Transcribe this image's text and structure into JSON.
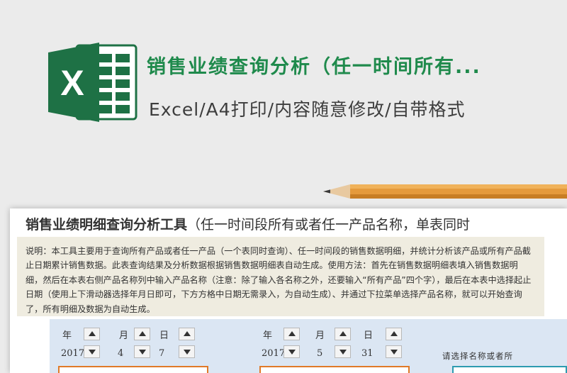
{
  "banner": {
    "title": "销售业绩查询分析（任一时间所有...",
    "subtitle": "Excel/A4打印/内容随意修改/自带格式"
  },
  "colors": {
    "excel_green": "#1e7145",
    "title_green": "#1f8a4c",
    "orange": "#e07a28",
    "teal": "#2d9bb0"
  },
  "sheet": {
    "title_bold": "销售业绩明细查询分析工具",
    "title_rest": "（任一时间段所有或者任一产品名称，单表同时",
    "description": "说明：本工具主要用于查询所有产品或者任一产品（一个表同时查询）、任一时间段的销售数据明细，并统计分析该产品或所有产品截止日期累计销售数据。此表查询结果及分析数据根据销售数据明细表自动生成。使用方法：首先在销售数据明细表填入销售数据明细，然后在本表右侧产品名称列中输入产品名称（注意：除了输入各名称之外，还要输入“所有产品”四个字），最后在本表中选择起止日期（使用上下滑动器选择年月日即可，下方方格中日期无需录入，为自动生成）、并通过下拉菜单选择产品名称，就可以开始查询了，所有明细及数据为自动生成。",
    "start_date": {
      "year_label": "年",
      "month_label": "月",
      "day_label": "日",
      "year": "2017",
      "month": "4",
      "day": "7"
    },
    "end_date": {
      "year_label": "年",
      "month_label": "月",
      "day_label": "日",
      "year": "2017",
      "month": "5",
      "day": "31"
    },
    "product_hint": "请选择名称或者所"
  }
}
